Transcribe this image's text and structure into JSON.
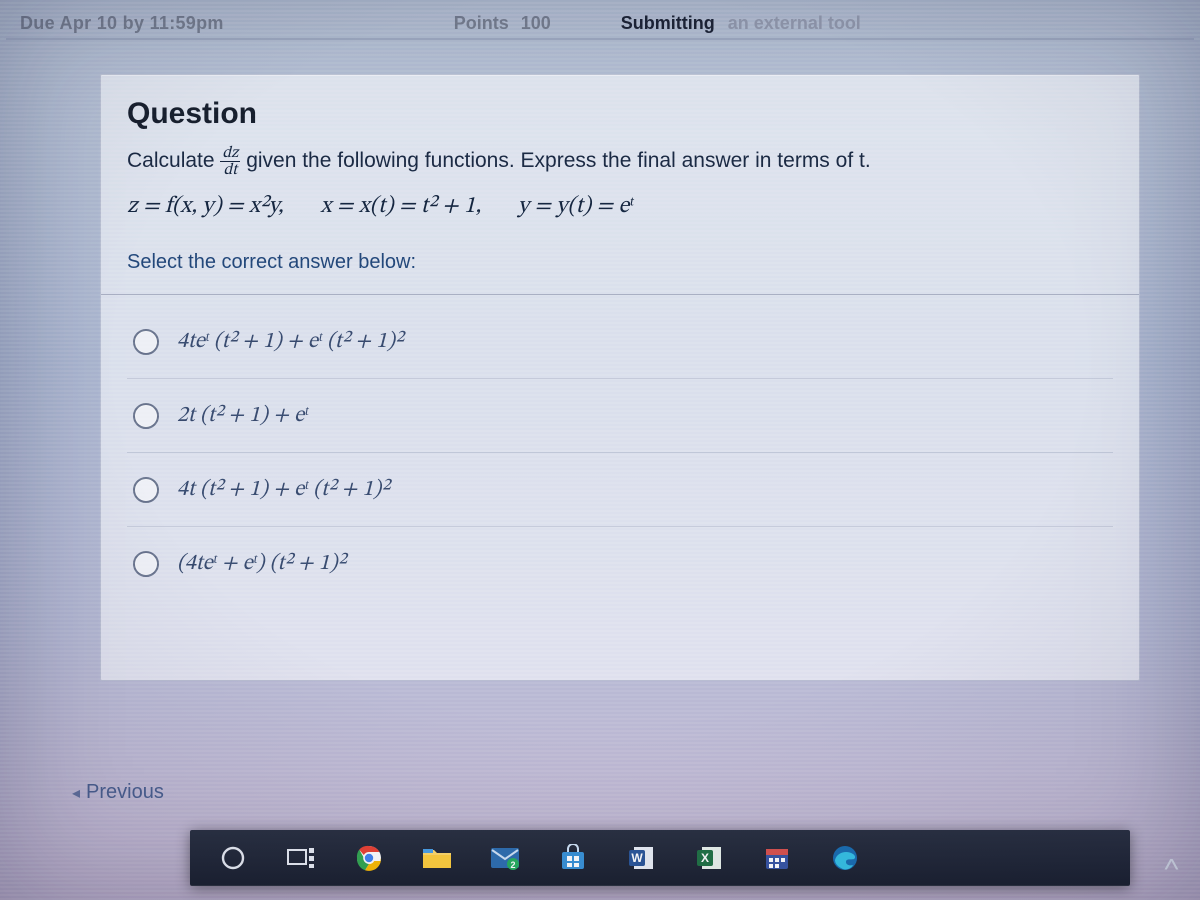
{
  "header": {
    "due_fragment": "Due   Apr 10 by 11:59pm",
    "points_label": "Points",
    "points_value": "100",
    "submitting_label": "Submitting",
    "submitting_value": "an external tool"
  },
  "question": {
    "title": "Question",
    "prompt_before": "Calculate ",
    "frac_top": "dz",
    "frac_bottom": "dt",
    "prompt_after": " given the following functions. Express the final answer in terms of  t.",
    "eq_z": "z = f(x, y) = x²y,",
    "eq_x": "x = x(t) = t² + 1,",
    "eq_y": "y = y(t) = eᵗ",
    "instruction": "Select the correct answer below:",
    "options": [
      "4teᵗ (t² + 1) + eᵗ (t² + 1)²",
      "2t (t² + 1) + eᵗ",
      "4t (t² + 1) + eᵗ (t² + 1)²",
      "(4teᵗ + eᵗ) (t² + 1)²"
    ]
  },
  "nav": {
    "previous": "Previous"
  },
  "taskbar": {
    "items": [
      "cortana-circle-icon",
      "task-view-icon",
      "chrome-icon",
      "file-explorer-icon",
      "mail-icon",
      "store-icon",
      "word-icon",
      "excel-icon",
      "calendar-icon",
      "edge-icon"
    ]
  }
}
